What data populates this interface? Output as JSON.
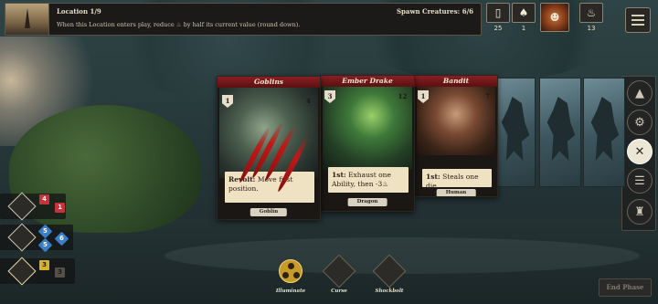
{
  "location": {
    "title": "Location 1/9",
    "description_before": "When this Location enters play, reduce",
    "description_after": "by half its current value (round down).",
    "spawn": "Spawn Creatures: 6/6"
  },
  "counters": [
    {
      "name": "deck-counter",
      "icon": "card-deck-icon",
      "glyph": "▯",
      "value": "25"
    },
    {
      "name": "discard-counter",
      "icon": "discard-pile-icon",
      "glyph": "♠",
      "value": "1"
    },
    {
      "name": "hero-portrait",
      "icon": "hero-portrait-icon",
      "glyph": "☻",
      "value": ""
    },
    {
      "name": "torch-counter",
      "icon": "torch-icon",
      "glyph": "♨",
      "value": "13"
    }
  ],
  "cards": [
    {
      "name": "Goblins",
      "attack": "1",
      "health": "4",
      "text_bold": "Revolt:",
      "text": " Move first position.",
      "type": "Goblin"
    },
    {
      "name": "Ember Drake",
      "attack": "3",
      "health": "12",
      "text_bold": "1st:",
      "text": " Exhaust one Ability, then -3",
      "type": "Dragon"
    },
    {
      "name": "Bandit",
      "attack": "1",
      "health": "7",
      "text_bold": "1st:",
      "text": " Steals one die.",
      "type": "Human"
    }
  ],
  "dice": {
    "row1": [
      "4",
      "1"
    ],
    "row2": [
      "5",
      "5",
      "6"
    ],
    "row3": [
      "3",
      "3"
    ]
  },
  "abilities": [
    {
      "label": "Illuminate",
      "icon": "illuminate-icon"
    },
    {
      "label": "Curse",
      "icon": "curse-icon"
    },
    {
      "label": "Shockbolt",
      "icon": "shockbolt-icon"
    }
  ],
  "sidebar": [
    "camp-tent-icon",
    "gears-icon",
    "crossed-swords-icon",
    "scroll-icon",
    "armor-icon"
  ],
  "end_phase": "End Phase",
  "colors": {
    "card_header": "#8a1f22",
    "die_red": "#c4323a",
    "die_blue": "#3a7ec8",
    "die_yellow": "#d8b228"
  }
}
